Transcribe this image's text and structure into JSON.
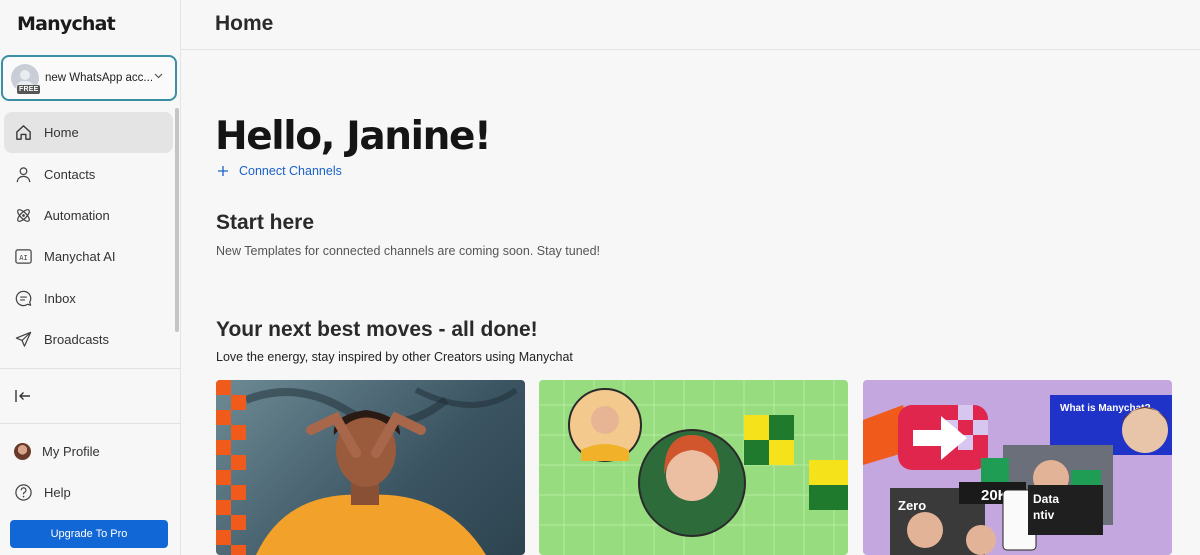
{
  "sidebar": {
    "logo": "Manychat",
    "account": {
      "name": "new WhatsApp acc...",
      "badge": "FREE"
    },
    "nav": [
      {
        "label": "Home",
        "icon": "home-icon",
        "active": true
      },
      {
        "label": "Contacts",
        "icon": "user-icon"
      },
      {
        "label": "Automation",
        "icon": "automation-icon"
      },
      {
        "label": "Manychat AI",
        "icon": "ai-icon"
      },
      {
        "label": "Inbox",
        "icon": "chat-icon"
      },
      {
        "label": "Broadcasts",
        "icon": "send-icon"
      }
    ],
    "profile_label": "My Profile",
    "help_label": "Help",
    "upgrade_label": "Upgrade To Pro"
  },
  "header": {
    "title": "Home"
  },
  "main": {
    "greeting": "Hello, Janine!",
    "connect_label": "Connect Channels",
    "start": {
      "title": "Start here",
      "subtitle": "New Templates for connected channels are coming soon. Stay tuned!"
    },
    "moves": {
      "title": "Your next best moves - all done!",
      "subtitle": "Love the energy, stay inspired by other Creators using Manychat"
    },
    "cards": [
      {
        "name": "creator-photo-card"
      },
      {
        "name": "templates-card"
      },
      {
        "name": "video-card",
        "texts": [
          "What is Manychat?",
          "Zero",
          "20K",
          "Data",
          "ntiv"
        ]
      }
    ]
  },
  "colors": {
    "accent": "#1267d6",
    "link": "#1a62c9",
    "account_border": "#3a8fa4"
  }
}
